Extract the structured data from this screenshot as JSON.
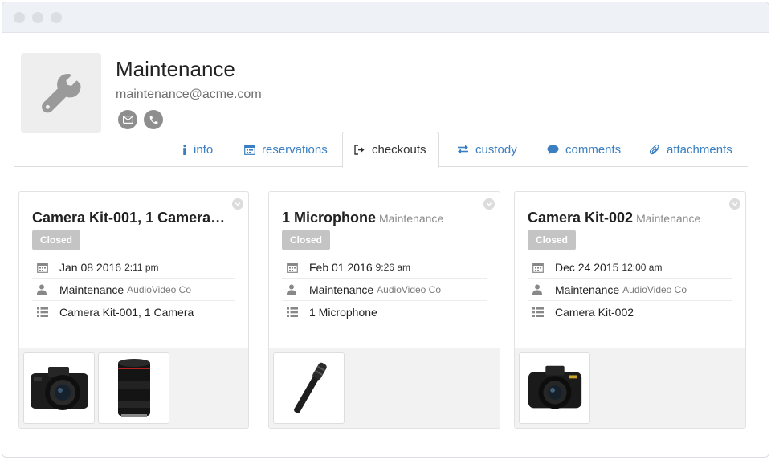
{
  "profile": {
    "name": "Maintenance",
    "email": "maintenance@acme.com",
    "avatar_icon": "wrench-icon",
    "contact_icons": [
      "email-icon",
      "phone-icon"
    ]
  },
  "tabs": [
    {
      "label": "info",
      "icon": "info-icon",
      "active": false
    },
    {
      "label": "reservations",
      "icon": "calendar-icon",
      "active": false
    },
    {
      "label": "checkouts",
      "icon": "sign-out-icon",
      "active": true
    },
    {
      "label": "custody",
      "icon": "exchange-icon",
      "active": false
    },
    {
      "label": "comments",
      "icon": "comment-icon",
      "active": false
    },
    {
      "label": "attachments",
      "icon": "paperclip-icon",
      "active": false
    }
  ],
  "colors": {
    "link": "#3a7fc1",
    "badge": "#c4c4c4",
    "thumb_bg": "#f2f2f2"
  },
  "cards": [
    {
      "title": "Camera Kit-001, 1 Camera…",
      "owner": "",
      "status": "Closed",
      "date": "Jan 08 2016",
      "time": "2:11 pm",
      "user": "Maintenance",
      "location": "AudioVideo Co",
      "items": "Camera Kit-001, 1 Camera",
      "thumbnails": [
        "dslr-camera-image",
        "camera-lens-image"
      ]
    },
    {
      "title": "1 Microphone",
      "owner": "Maintenance",
      "status": "Closed",
      "date": "Feb 01 2016",
      "time": "9:26 am",
      "user": "Maintenance",
      "location": "AudioVideo Co",
      "items": "1 Microphone",
      "thumbnails": [
        "microphone-image"
      ]
    },
    {
      "title": "Camera Kit-002",
      "owner": "Maintenance",
      "status": "Closed",
      "date": "Dec 24 2015",
      "time": "12:00 am",
      "user": "Maintenance",
      "location": "AudioVideo Co",
      "items": "Camera Kit-002",
      "thumbnails": [
        "dslr-camera-image"
      ]
    }
  ]
}
